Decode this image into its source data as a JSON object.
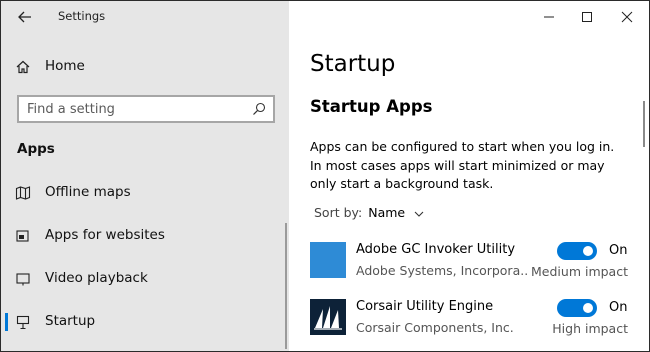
{
  "window": {
    "title": "Settings",
    "accent": "#0078d7",
    "sidebar_bg": "#e6e6e6"
  },
  "sidebar": {
    "home_label": "Home",
    "search": {
      "placeholder": "Find a setting"
    },
    "section_heading": "Apps",
    "items": [
      {
        "label": "Offline maps",
        "icon": "map-icon"
      },
      {
        "label": "Apps for websites",
        "icon": "link-window-icon"
      },
      {
        "label": "Video playback",
        "icon": "video-icon"
      },
      {
        "label": "Startup",
        "icon": "startup-icon",
        "selected": true
      }
    ]
  },
  "main": {
    "page_title": "Startup",
    "sub_title": "Startup Apps",
    "description": "Apps can be configured to start when you log in. In most cases apps will start minimized or may only start a background task.",
    "sort": {
      "label": "Sort by:",
      "value": "Name"
    },
    "apps": [
      {
        "name": "Adobe GC Invoker Utility",
        "publisher": "Adobe Systems, Incorpora...",
        "toggle_state": "On",
        "impact": "Medium impact",
        "icon": "adobe-app-icon",
        "icon_color": "#2e8bd6"
      },
      {
        "name": "Corsair Utility Engine",
        "publisher": "Corsair Components, Inc.",
        "toggle_state": "On",
        "impact": "High impact",
        "icon": "corsair-logo-icon",
        "icon_color": "#0d2238"
      }
    ]
  }
}
